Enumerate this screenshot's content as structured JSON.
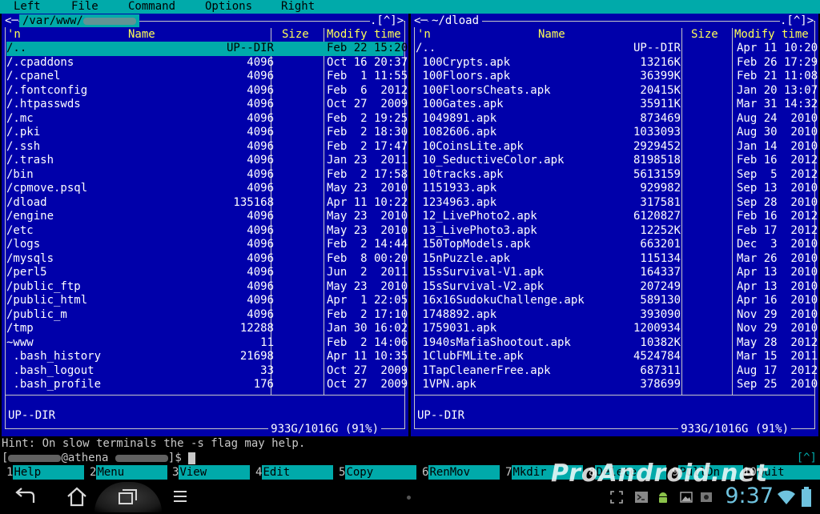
{
  "menubar": {
    "items": [
      {
        "label": "Left"
      },
      {
        "label": "File"
      },
      {
        "label": "Command"
      },
      {
        "label": "Options"
      },
      {
        "label": "Right"
      }
    ]
  },
  "left_panel": {
    "path": "/var/www/",
    "corner": ".[^]>",
    "head_n": "'n",
    "head_name": "Name",
    "head_size": "Size",
    "head_time": "Modify time",
    "rows": [
      {
        "name": "/..",
        "size": "UP--DIR",
        "time": "Feb 22 15:20"
      },
      {
        "name": "/.cpaddons",
        "size": "4096",
        "time": "Oct 16 20:37"
      },
      {
        "name": "/.cpanel",
        "size": "4096",
        "time": "Feb  1 11:55"
      },
      {
        "name": "/.fontconfig",
        "size": "4096",
        "time": "Feb  6  2012"
      },
      {
        "name": "/.htpasswds",
        "size": "4096",
        "time": "Oct 27  2009"
      },
      {
        "name": "/.mc",
        "size": "4096",
        "time": "Feb  2 19:25"
      },
      {
        "name": "/.pki",
        "size": "4096",
        "time": "Feb  2 18:30"
      },
      {
        "name": "/.ssh",
        "size": "4096",
        "time": "Feb  2 17:47"
      },
      {
        "name": "/.trash",
        "size": "4096",
        "time": "Jan 23  2011"
      },
      {
        "name": "/bin",
        "size": "4096",
        "time": "Feb  2 17:58"
      },
      {
        "name": "/cpmove.psql",
        "size": "4096",
        "time": "May 23  2010"
      },
      {
        "name": "/dload",
        "size": "135168",
        "time": "Apr 11 10:22"
      },
      {
        "name": "/engine",
        "size": "4096",
        "time": "May 23  2010"
      },
      {
        "name": "/etc",
        "size": "4096",
        "time": "May 23  2010"
      },
      {
        "name": "/logs",
        "size": "4096",
        "time": "Feb  2 14:44"
      },
      {
        "name": "/mysqls",
        "size": "4096",
        "time": "Feb  8 00:20"
      },
      {
        "name": "/perl5",
        "size": "4096",
        "time": "Jun  2  2011"
      },
      {
        "name": "/public_ftp",
        "size": "4096",
        "time": "May 23  2010"
      },
      {
        "name": "/public_html",
        "size": "4096",
        "time": "Apr  1 22:05"
      },
      {
        "name": "/public_m",
        "size": "4096",
        "time": "Feb  2 17:10"
      },
      {
        "name": "/tmp",
        "size": "12288",
        "time": "Jan 30 16:02"
      },
      {
        "name": "~www",
        "size": "11",
        "time": "Feb  2 14:06"
      },
      {
        "name": " .bash_history",
        "size": "21698",
        "time": "Apr 11 10:35"
      },
      {
        "name": " .bash_logout",
        "size": "33",
        "time": "Oct 27  2009"
      },
      {
        "name": " .bash_profile",
        "size": "176",
        "time": "Oct 27  2009"
      }
    ],
    "status": "UP--DIR",
    "free": "933G/1016G (91%)"
  },
  "right_panel": {
    "path": "~/dload",
    "corner": ".[^]>",
    "head_n": "'n",
    "head_name": "Name",
    "head_size": "Size",
    "head_time": "Modify time",
    "rows": [
      {
        "name": "/..",
        "size": "UP--DIR",
        "time": "Apr 11 10:20"
      },
      {
        "name": " 100Crypts.apk",
        "size": "13216K",
        "time": "Feb 26 17:29"
      },
      {
        "name": " 100Floors.apk",
        "size": "36399K",
        "time": "Feb 21 11:08"
      },
      {
        "name": " 100FloorsCheats.apk",
        "size": "20415K",
        "time": "Jan 20 13:07"
      },
      {
        "name": " 100Gates.apk",
        "size": "35911K",
        "time": "Mar 31 14:32"
      },
      {
        "name": " 1049891.apk",
        "size": "873469",
        "time": "Aug 24  2010"
      },
      {
        "name": " 1082606.apk",
        "size": "1033093",
        "time": "Aug 30  2010"
      },
      {
        "name": " 10CoinsLite.apk",
        "size": "2929452",
        "time": "Jan 14  2010"
      },
      {
        "name": " 10_SeductiveColor.apk",
        "size": "8198518",
        "time": "Feb 16  2012"
      },
      {
        "name": " 10tracks.apk",
        "size": "5613159",
        "time": "Sep  5  2012"
      },
      {
        "name": " 1151933.apk",
        "size": "929982",
        "time": "Sep 13  2010"
      },
      {
        "name": " 1234963.apk",
        "size": "317581",
        "time": "Sep 28  2010"
      },
      {
        "name": " 12_LivePhoto2.apk",
        "size": "6120827",
        "time": "Feb 16  2012"
      },
      {
        "name": " 13_LivePhoto3.apk",
        "size": "12252K",
        "time": "Feb 17  2012"
      },
      {
        "name": " 150TopModels.apk",
        "size": "663201",
        "time": "Dec  3  2010"
      },
      {
        "name": " 15nPuzzle.apk",
        "size": "115134",
        "time": "Mar 26  2010"
      },
      {
        "name": " 15sSurvival-V1.apk",
        "size": "164337",
        "time": "Apr 13  2010"
      },
      {
        "name": " 15sSurvival-V2.apk",
        "size": "207249",
        "time": "Apr 13  2010"
      },
      {
        "name": " 16x16SudokuChallenge.apk",
        "size": "589130",
        "time": "Apr 16  2010"
      },
      {
        "name": " 1748892.apk",
        "size": "393090",
        "time": "Nov 29  2010"
      },
      {
        "name": " 1759031.apk",
        "size": "1200934",
        "time": "Nov 29  2010"
      },
      {
        "name": " 1940sMafiaShootout.apk",
        "size": "10382K",
        "time": "May 28  2012"
      },
      {
        "name": " 1ClubFMLite.apk",
        "size": "4524784",
        "time": "Mar 15  2011"
      },
      {
        "name": " 1TapCleanerFree.apk",
        "size": "687311",
        "time": "Aug 17  2012"
      },
      {
        "name": " 1VPN.apk",
        "size": "378699",
        "time": "Sep 25  2010"
      }
    ],
    "status": "UP--DIR",
    "free": "933G/1016G (91%)"
  },
  "terminal": {
    "hint": "Hint: On slow terminals the -s flag may help.",
    "prompt_open": "[",
    "prompt_host": "@athena",
    "prompt_close": "]$",
    "indicator": "[^]"
  },
  "fkeys": [
    {
      "num": "1",
      "label": "Help"
    },
    {
      "num": "2",
      "label": "Menu"
    },
    {
      "num": "3",
      "label": "View"
    },
    {
      "num": "4",
      "label": "Edit"
    },
    {
      "num": "5",
      "label": "Copy"
    },
    {
      "num": "6",
      "label": "RenMov"
    },
    {
      "num": "7",
      "label": "Mkdir"
    },
    {
      "num": "8",
      "label": "Delete"
    },
    {
      "num": "9",
      "label": "PullDn"
    },
    {
      "num": "10",
      "label": "Quit"
    }
  ],
  "watermark": "ProAndroid.net",
  "statusbar": {
    "clock": "9:37"
  },
  "colors": {
    "panel_bg": "#0000aa",
    "accent_cyan": "#00aaaa",
    "header_yellow": "#ffff55",
    "clock_blue": "#6fc3df"
  },
  "icons": [
    "back-icon",
    "home-icon",
    "recent-apps-icon",
    "menu-icon",
    "screenshot-icon",
    "terminal-icon",
    "android-icon",
    "image-icon",
    "wifi-icon",
    "battery-icon"
  ]
}
